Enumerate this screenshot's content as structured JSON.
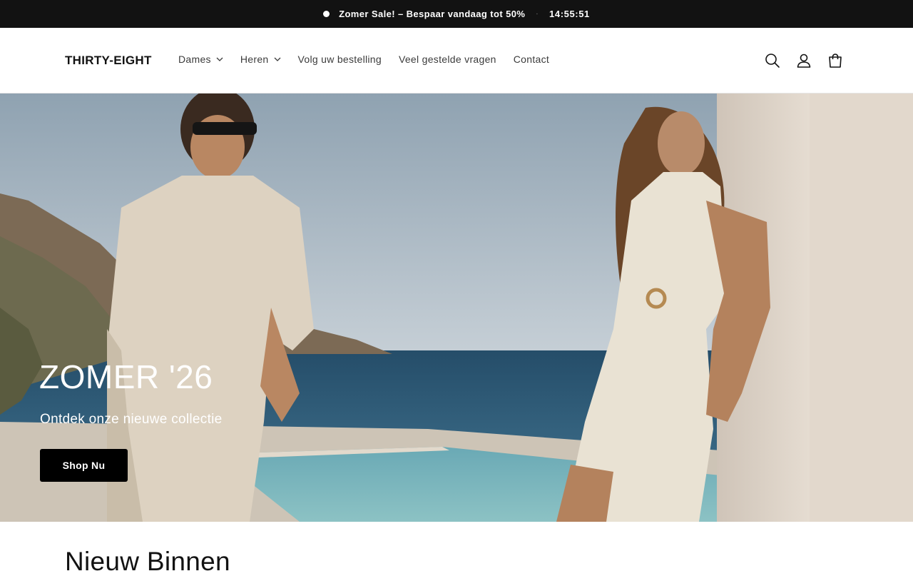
{
  "announcement": {
    "message": "Zomer Sale! – Bespaar vandaag tot 50%",
    "separator": "·",
    "timer": "14:55:51"
  },
  "header": {
    "logo": "THIRTY-EIGHT",
    "nav": [
      {
        "label": "Dames",
        "has_dropdown": true
      },
      {
        "label": "Heren",
        "has_dropdown": true
      },
      {
        "label": "Volg uw bestelling",
        "has_dropdown": false
      },
      {
        "label": "Veel gestelde vragen",
        "has_dropdown": false
      },
      {
        "label": "Contact",
        "has_dropdown": false
      }
    ],
    "icons": [
      "search-icon",
      "account-icon",
      "cart-icon"
    ]
  },
  "hero": {
    "title": "ZOMER '26",
    "subtitle": "Ontdek onze nieuwe collectie",
    "cta": "Shop Nu"
  },
  "section": {
    "title": "Nieuw Binnen"
  },
  "colors": {
    "announcement_bg": "#121212",
    "text": "#121212",
    "button_bg": "#000000",
    "sea": "#2f5873",
    "sky": "#aab8c4"
  }
}
